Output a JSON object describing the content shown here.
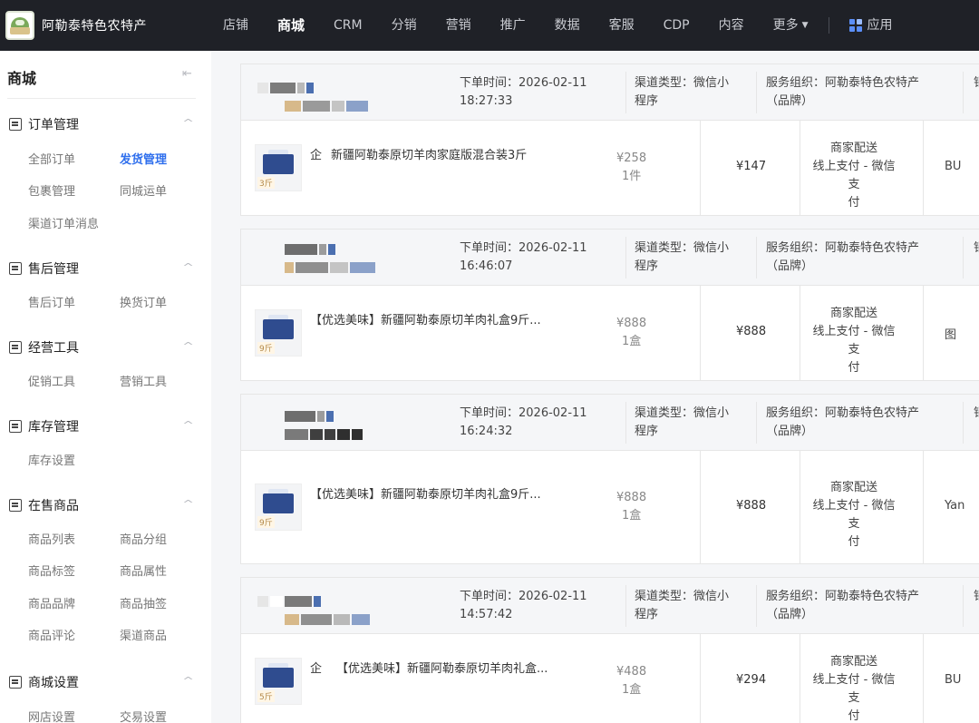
{
  "brand": {
    "name": "阿勒泰特色农特产"
  },
  "nav": {
    "items": [
      "店铺",
      "商城",
      "CRM",
      "分销",
      "营销",
      "推广",
      "数据",
      "客服",
      "CDP",
      "内容",
      "更多"
    ],
    "active": "商城",
    "apps_label": "应用"
  },
  "sidebar": {
    "title": "商城",
    "groups": [
      {
        "label": "订单管理",
        "icon": "order-icon",
        "items": [
          "全部订单",
          "发货管理",
          "包裹管理",
          "同城运单",
          "渠道订单消息"
        ],
        "active": "发货管理"
      },
      {
        "label": "售后管理",
        "icon": "aftersale-icon",
        "items": [
          "售后订单",
          "换货订单"
        ]
      },
      {
        "label": "经营工具",
        "icon": "chart-icon",
        "items": [
          "促销工具",
          "营销工具"
        ]
      },
      {
        "label": "库存管理",
        "icon": "inventory-icon",
        "items": [
          "库存设置"
        ]
      },
      {
        "label": "在售商品",
        "icon": "product-icon",
        "items": [
          "商品列表",
          "商品分组",
          "商品标签",
          "商品属性",
          "商品品牌",
          "商品抽签",
          "商品评论",
          "渠道商品"
        ]
      },
      {
        "label": "商城设置",
        "icon": "settings-icon",
        "items": [
          "网店设置",
          "交易设置"
        ]
      }
    ]
  },
  "orders": [
    {
      "time_label": "下单时间：2026-02-11",
      "time": "18:27:33",
      "channel_l1": "渠道类型：微信小",
      "channel_l2": "程序",
      "org_l1": "服务组织：阿勒泰特色农特产",
      "org_l2": "（品牌）",
      "edge_head": "销",
      "thumb_label": "3斤",
      "enterprise": "企",
      "name": "新疆阿勒泰原切羊肉家庭版混合装3斤",
      "unit_price": "¥258",
      "qty": "1件",
      "paid": "¥147",
      "ship": "商家配送",
      "pay_l1": "线上支付 - 微信支",
      "pay_l2": "付",
      "edge_body": "BU"
    },
    {
      "time_label": "下单时间：2026-02-11",
      "time": "16:46:07",
      "channel_l1": "渠道类型：微信小",
      "channel_l2": "程序",
      "org_l1": "服务组织：阿勒泰特色农特产",
      "org_l2": "（品牌）",
      "edge_head": "销",
      "thumb_label": "9斤",
      "enterprise": "",
      "name": "【优选美味】新疆阿勒泰原切羊肉礼盒9斤...",
      "unit_price": "¥888",
      "qty": "1盒",
      "paid": "¥888",
      "ship": "商家配送",
      "pay_l1": "线上支付 - 微信支",
      "pay_l2": "付",
      "edge_body": "图"
    },
    {
      "time_label": "下单时间：2026-02-11",
      "time": "16:24:32",
      "channel_l1": "渠道类型：微信小",
      "channel_l2": "程序",
      "org_l1": "服务组织：阿勒泰特色农特产",
      "org_l2": "（品牌）",
      "edge_head": "销",
      "thumb_label": "9斤",
      "enterprise": "",
      "name": "【优选美味】新疆阿勒泰原切羊肉礼盒9斤...",
      "unit_price": "¥888",
      "qty": "1盒",
      "paid": "¥888",
      "ship": "商家配送",
      "pay_l1": "线上支付 - 微信支",
      "pay_l2": "付",
      "edge_body": "Yan"
    },
    {
      "time_label": "下单时间：2026-02-11",
      "time": "14:57:42",
      "channel_l1": "渠道类型：微信小",
      "channel_l2": "程序",
      "org_l1": "服务组织：阿勒泰特色农特产",
      "org_l2": "（品牌）",
      "edge_head": "销",
      "thumb_label": "5斤",
      "enterprise": "企",
      "name": "【优选美味】新疆阿勒泰原切羊肉礼盒...",
      "unit_price": "¥488",
      "qty": "1盒",
      "paid": "¥294",
      "ship": "商家配送",
      "pay_l1": "线上支付 - 微信支",
      "pay_l2": "付",
      "edge_body": "BU"
    }
  ]
}
